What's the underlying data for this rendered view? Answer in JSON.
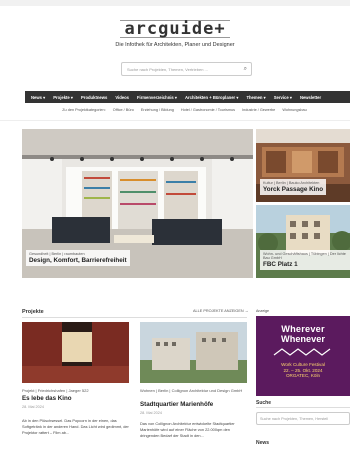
{
  "brand": {
    "logo": "arcguide+",
    "tagline": "Die Infothek für Architekten, Planer und Designer"
  },
  "search": {
    "placeholder": "Suche nach Projekten, Themen, Vertrieben ...",
    "side_placeholder": "Suche nach Projekten, Themen, Herstell"
  },
  "nav": [
    "News ▾",
    "Projekte ▾",
    "Produktnews",
    "Videos",
    "Firmenverzeichnis ▾",
    "Architekten + Büroplaner ▾",
    "Themen ▾",
    "Service ▾",
    "Newsletter"
  ],
  "subnav": {
    "label": "Zu den Projektkategorien:",
    "items": [
      "Office / Büro",
      "Erziehung / Bildung",
      "Hotel / Gastronomie / Tourismus",
      "Industrie / Gewerbe",
      "Wohnungsbau"
    ]
  },
  "hero": {
    "main": {
      "meta": "Gesundheit | Berlin | raumbauten",
      "title": "Design, Komfort, Barrierefreiheit"
    },
    "side1": {
      "meta": "Kultur | Berlin | Bauko Architekten",
      "title": "Yorck Passage Kino"
    },
    "side2": {
      "meta": "Wohn- und Geschäftshaus | Tübingen | Der lichte Bau GmbH",
      "title": "FBC Platz 1"
    }
  },
  "projects": {
    "heading": "Projekte",
    "show_all": "ALLE PROJEKTE ANZEIGEN →",
    "cards": [
      {
        "meta": "Projekt | Friedrichshafen | Jaeger 522",
        "title": "Es lebe das Kino",
        "date": "28. Mai 2024",
        "text": "Ab in den Plüschsessel. Das Popcorn in der einen, das Softgetränk in der anderen Hand. Das Licht wird gedimmt, der Projektor rattert – Film ab..."
      },
      {
        "meta": "Wohnen | Berlin | Collignon Architektur und Design GmbH",
        "title": "Stadtquartier Marienhöfe",
        "date": "28. Mai 2024",
        "text": "Das von Collignon Architektur entwickelte Stadtquartier Marienhöfe wird auf einer Fläche von 22.000qm den dringenden Bedarf der Stadt in den..."
      }
    ]
  },
  "sidebar": {
    "ad_label": "Anzeige",
    "ad": {
      "line1": "Wherever",
      "line2": "Whenever",
      "event": "Work Culture Festival",
      "dates": "22. – 25. Okt. 2024",
      "venue": "ORGATEC, Köln",
      "accent": "#ffd86e",
      "bg": "#5b1a5e"
    },
    "search_heading": "Suche",
    "news_heading": "News"
  }
}
